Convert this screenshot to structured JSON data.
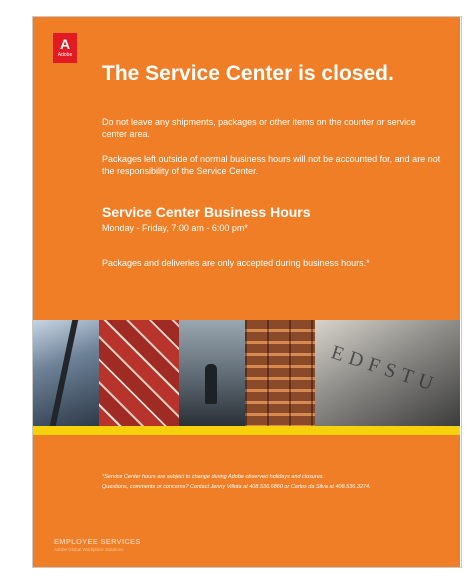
{
  "logo": {
    "mark": "A",
    "wordmark": "Adobe"
  },
  "headline": "The Service Center is closed.",
  "notice": {
    "para1": "Do not leave any shipments, packages or other items on the counter or service center area.",
    "para2": "Packages left outside of normal business hours will not be accounted for, and are not the responsibility of the Service Center."
  },
  "hours": {
    "title": "Service Center Business Hours",
    "schedule": "Monday - Friday, 7:00 am - 6:00 pm*"
  },
  "deliveries_note": "Packages and deliveries are only accepted during business hours.*",
  "photo_strip": {
    "engraved_text": "EDFSTU"
  },
  "footnote": {
    "line1": "*Service Center hours are subject to change during Adobe observed holidays and closures.",
    "line2": "Questions, comments or concerns? Contact Jenny Villota at 408.536.6860 or Carlos da Silva at 408.536.3274."
  },
  "footer": {
    "title": "EMPLOYEE SERVICES",
    "subtitle": "Adobe Global Workplace Solutions"
  },
  "colors": {
    "poster_orange": "#f07e26",
    "logo_red": "#e21b23",
    "band_yellow": "#f6d10c"
  }
}
